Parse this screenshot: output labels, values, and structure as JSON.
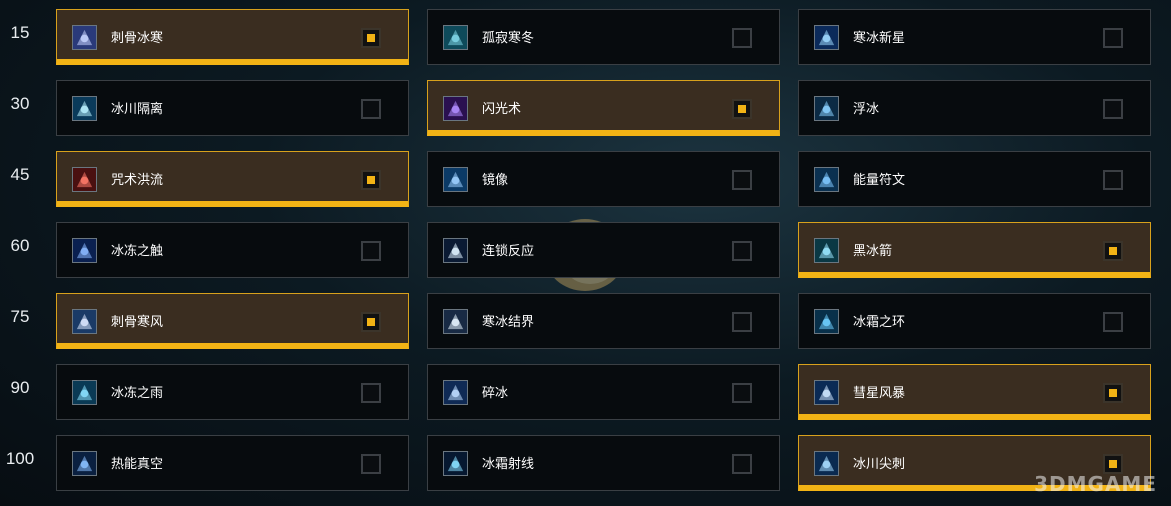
{
  "rows": [
    {
      "level": "15",
      "talents": [
        {
          "name": "刺骨冰寒",
          "selected": true,
          "icon": "skull-icon"
        },
        {
          "name": "孤寂寒冬",
          "selected": false,
          "icon": "frost-figure-icon"
        },
        {
          "name": "寒冰新星",
          "selected": false,
          "icon": "ice-nova-icon"
        }
      ]
    },
    {
      "level": "30",
      "talents": [
        {
          "name": "冰川隔离",
          "selected": false,
          "icon": "ice-block-icon"
        },
        {
          "name": "闪光术",
          "selected": true,
          "icon": "shimmer-icon"
        },
        {
          "name": "浮冰",
          "selected": false,
          "icon": "ice-floes-icon"
        }
      ]
    },
    {
      "level": "45",
      "talents": [
        {
          "name": "咒术洪流",
          "selected": true,
          "icon": "hand-icon"
        },
        {
          "name": "镜像",
          "selected": false,
          "icon": "mirror-image-icon"
        },
        {
          "name": "能量符文",
          "selected": false,
          "icon": "rune-icon"
        }
      ]
    },
    {
      "level": "60",
      "talents": [
        {
          "name": "冰冻之触",
          "selected": false,
          "icon": "frost-touch-icon"
        },
        {
          "name": "连锁反应",
          "selected": false,
          "icon": "chain-reaction-icon"
        },
        {
          "name": "黑冰箭",
          "selected": true,
          "icon": "ebonbolt-icon"
        }
      ]
    },
    {
      "level": "75",
      "talents": [
        {
          "name": "刺骨寒风",
          "selected": true,
          "icon": "frigid-winds-icon"
        },
        {
          "name": "寒冰结界",
          "selected": false,
          "icon": "ice-ward-icon"
        },
        {
          "name": "冰霜之环",
          "selected": false,
          "icon": "ring-of-frost-icon"
        }
      ]
    },
    {
      "level": "90",
      "talents": [
        {
          "name": "冰冻之雨",
          "selected": false,
          "icon": "freezing-rain-icon"
        },
        {
          "name": "碎冰",
          "selected": false,
          "icon": "splitting-ice-icon"
        },
        {
          "name": "彗星风暴",
          "selected": true,
          "icon": "comet-storm-icon"
        }
      ]
    },
    {
      "level": "100",
      "talents": [
        {
          "name": "热能真空",
          "selected": false,
          "icon": "thermal-void-icon"
        },
        {
          "name": "冰霜射线",
          "selected": false,
          "icon": "ray-of-frost-icon"
        },
        {
          "name": "冰川尖刺",
          "selected": true,
          "icon": "glacial-spike-icon"
        }
      ]
    }
  ],
  "watermark": {
    "text": "3DMGAME"
  },
  "colors": {
    "accent": "#f2b315",
    "selected_bg": "#3a2d20",
    "tile_bg": "#070b0e",
    "tile_border": "#3a3f44"
  }
}
